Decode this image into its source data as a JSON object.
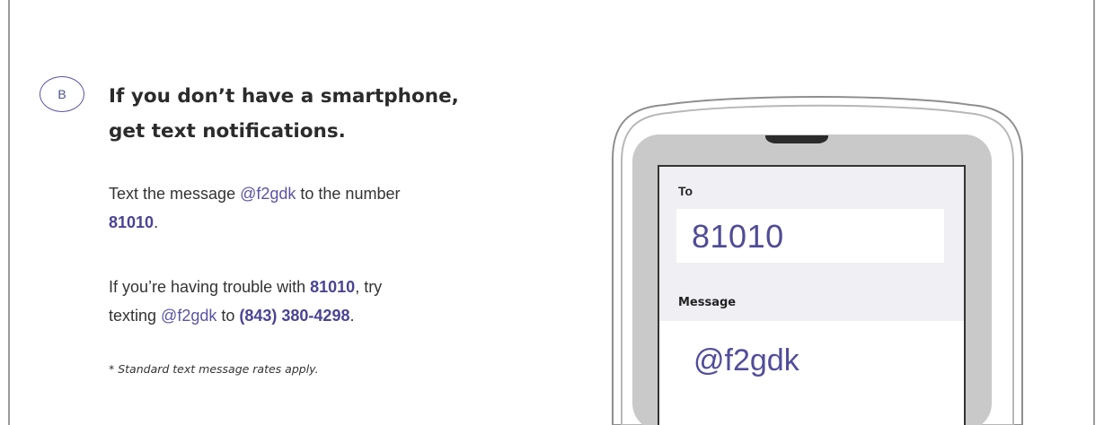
{
  "step": {
    "badge": "B",
    "heading_line1": "If you don’t have a smartphone,",
    "heading_line2": "get text notifications."
  },
  "instructions": {
    "p1_a": "Text the message ",
    "p1_code": "@f2gdk",
    "p1_b": " to the number",
    "p1_number": "81010",
    "p1_end": ".",
    "p2_a": "If you’re having trouble with ",
    "p2_number": "81010",
    "p2_b": ", try",
    "p2_c": "texting ",
    "p2_code": "@f2gdk",
    "p2_d": " to ",
    "p2_phone": "(843) 380-4298",
    "p2_end": "."
  },
  "footnote": "* Standard text message rates apply.",
  "phone": {
    "to_label": "To",
    "to_value": "81010",
    "message_label": "Message",
    "message_value": "@f2gdk"
  },
  "colors": {
    "accent": "#5a54a5",
    "screen_panel": "#f0eff4",
    "phone_body": "#c9c9c9"
  }
}
